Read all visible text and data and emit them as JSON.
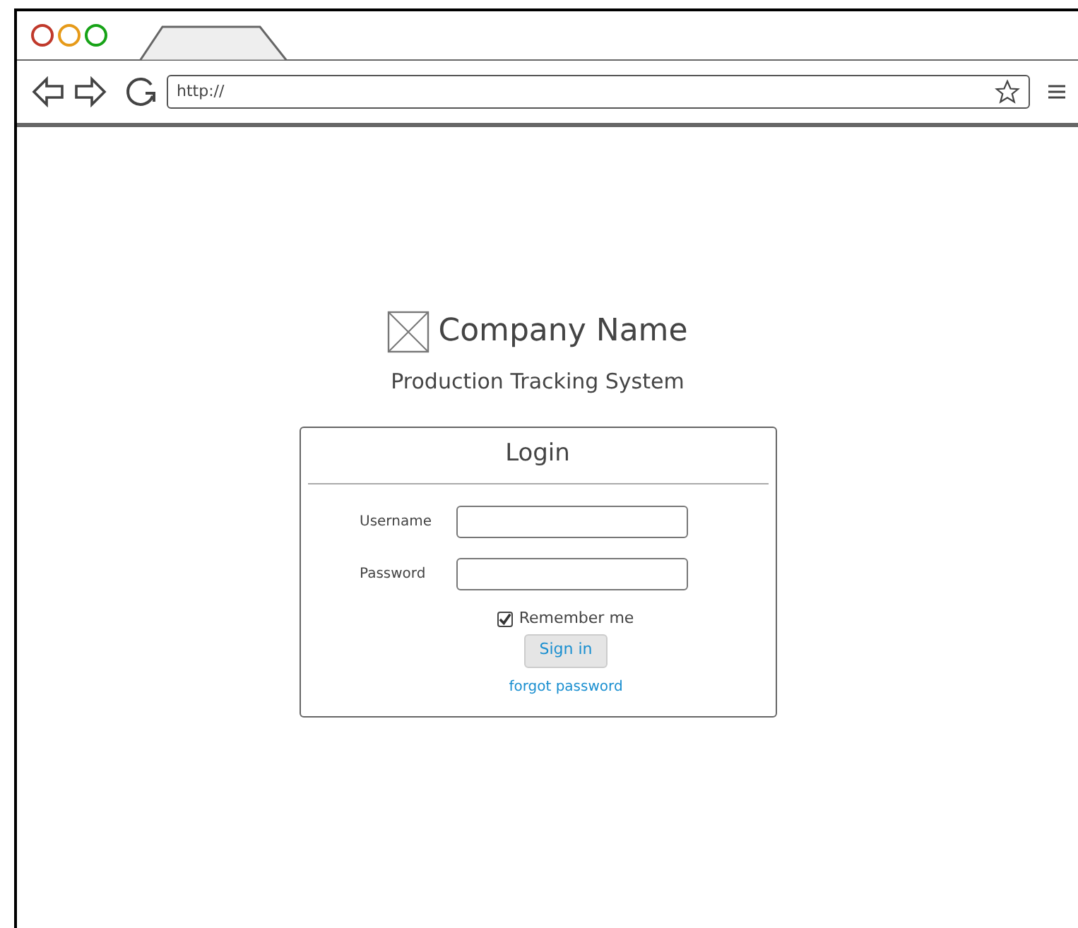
{
  "browser": {
    "address": "http://"
  },
  "brand": {
    "name": "Company Name",
    "subtitle": "Production Tracking System"
  },
  "login": {
    "title": "Login",
    "fields": [
      {
        "label": "Username"
      },
      {
        "label": "Password"
      }
    ],
    "remember": {
      "label": "Remember me",
      "checked": true
    },
    "button": "Sign in",
    "link": "forgot password"
  }
}
